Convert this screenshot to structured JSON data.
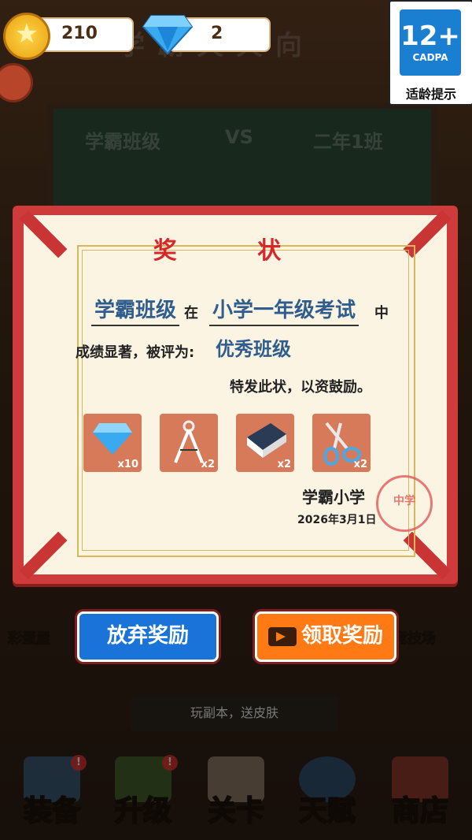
{
  "top_bar": {
    "coins": "210",
    "gems": "2"
  },
  "age_rating": {
    "number": "12+",
    "org": "CADPA",
    "label": "适龄提示"
  },
  "certificate": {
    "title": "奖 状",
    "class_name": "学霸班级",
    "in_word": "在",
    "exam_name": "小学一年级考试",
    "middle_word": "中",
    "result_prefix": "成绩显著，被评为:",
    "honor": "优秀班级",
    "closing": "特发此状，以资鼓励。",
    "rewards": [
      {
        "icon": "gem-icon",
        "quantity": "x10"
      },
      {
        "icon": "compass-icon",
        "quantity": "x2"
      },
      {
        "icon": "eraser-icon",
        "quantity": "x2"
      },
      {
        "icon": "scissors-icon",
        "quantity": "x2"
      }
    ],
    "school": "学霸小学",
    "date": "2026年3月1日",
    "stamp_text": "中学"
  },
  "buttons": {
    "abandon": "放弃奖励",
    "claim": "领取奖励"
  },
  "hint": "玩副本，送皮肤",
  "nav": [
    {
      "label": "装备",
      "badge": "!"
    },
    {
      "label": "升级",
      "badge": "!"
    },
    {
      "label": "关卡",
      "badge": ""
    },
    {
      "label": "天赋",
      "badge": ""
    },
    {
      "label": "商店",
      "badge": ""
    }
  ],
  "side": {
    "left": "彩蛋屋",
    "right": "竞技场"
  },
  "background": {
    "title": "学霸天天向",
    "board_left": "学霸班级",
    "board_vs": "VS",
    "board_right": "二年1班"
  }
}
